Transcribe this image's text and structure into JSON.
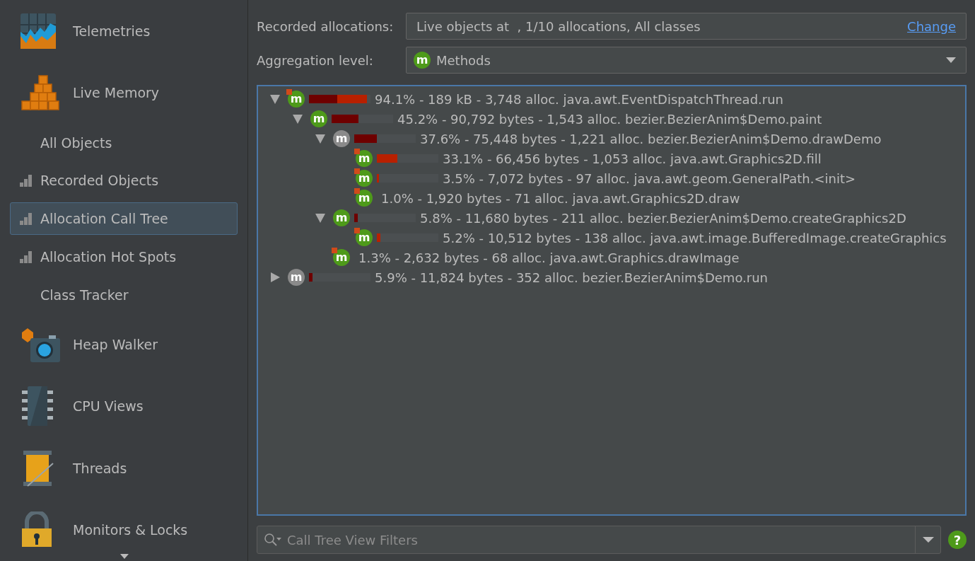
{
  "sidebar": {
    "items": [
      {
        "kind": "section",
        "label": "Telemetries",
        "selected": false
      },
      {
        "kind": "section",
        "label": "Live Memory",
        "selected": false
      },
      {
        "kind": "view",
        "recorded": false,
        "label": "All Objects",
        "selected": false
      },
      {
        "kind": "view",
        "recorded": true,
        "label": "Recorded Objects",
        "selected": false
      },
      {
        "kind": "view",
        "recorded": true,
        "label": "Allocation Call Tree",
        "selected": true
      },
      {
        "kind": "view",
        "recorded": true,
        "label": "Allocation Hot Spots",
        "selected": false
      },
      {
        "kind": "view",
        "recorded": false,
        "label": "Class Tracker",
        "selected": false
      },
      {
        "kind": "section",
        "label": "Heap Walker",
        "selected": false
      },
      {
        "kind": "section",
        "label": "CPU Views",
        "selected": false
      },
      {
        "kind": "section",
        "label": "Threads",
        "selected": false
      },
      {
        "kind": "section",
        "label": "Monitors & Locks",
        "selected": false
      }
    ]
  },
  "recorded_allocations": {
    "label": "Recorded allocations:",
    "value": "Live objects at  , 1/10 allocations, All classes",
    "link": "Change"
  },
  "aggregation_level": {
    "label": "Aggregation level:",
    "icon_text": "m",
    "value": "Methods"
  },
  "tree": [
    {
      "expanded": true,
      "icon_text": "m",
      "greyed": false,
      "hot": true,
      "bars": [
        {
          "kind": "inherent",
          "level": 0.46
        },
        {
          "kind": "self",
          "level": 0.48
        }
      ],
      "text": "94.1% - 189 kB - 3,748 alloc. java.awt.EventDispatchThread.run",
      "children": [
        {
          "expanded": true,
          "icon_text": "m",
          "greyed": false,
          "hot": false,
          "bars": [
            {
              "kind": "inherent",
              "level": 0.44
            }
          ],
          "text": "45.2% - 90,792 bytes - 1,543 alloc. bezier.BezierAnim$Demo.paint",
          "children": [
            {
              "expanded": true,
              "icon_text": "m",
              "greyed": true,
              "hot": false,
              "bars": [
                {
                  "kind": "inherent",
                  "level": 0.37
                }
              ],
              "text": "37.6% - 75,448 bytes - 1,221 alloc. bezier.BezierAnim$Demo.drawDemo",
              "children": [
                {
                  "icon_text": "m",
                  "greyed": false,
                  "hot": true,
                  "bars": [
                    {
                      "kind": "self",
                      "level": 0.33
                    }
                  ],
                  "text": "33.1% - 66,456 bytes - 1,053 alloc. java.awt.Graphics2D.fill"
                },
                {
                  "icon_text": "m",
                  "greyed": false,
                  "hot": true,
                  "bars": [
                    {
                      "kind": "self",
                      "level": 0.035
                    }
                  ],
                  "text": "3.5% - 7,072 bytes - 97 alloc. java.awt.geom.GeneralPath.<init>"
                },
                {
                  "icon_text": "m",
                  "greyed": false,
                  "hot": true,
                  "text": "1.0% - 1,920 bytes - 71 alloc. java.awt.Graphics2D.draw"
                }
              ]
            },
            {
              "expanded": true,
              "icon_text": "m",
              "greyed": false,
              "hot": false,
              "bars": [
                {
                  "kind": "inherent",
                  "level": 0.058
                }
              ],
              "text": "5.8% - 11,680 bytes - 211 alloc. bezier.BezierAnim$Demo.createGraphics2D",
              "children": [
                {
                  "icon_text": "m",
                  "greyed": false,
                  "hot": true,
                  "bars": [
                    {
                      "kind": "self",
                      "level": 0.052
                    }
                  ],
                  "text": "5.2% - 10,512 bytes - 138 alloc. java.awt.image.BufferedImage.createGraphics"
                }
              ]
            },
            {
              "icon_text": "m",
              "greyed": false,
              "hot": true,
              "text": "1.3% - 2,632 bytes - 68 alloc. java.awt.Graphics.drawImage"
            }
          ]
        }
      ]
    },
    {
      "expanded": false,
      "icon_text": "m",
      "greyed": true,
      "hot": false,
      "bars": [
        {
          "kind": "inherent",
          "level": 0.059
        }
      ],
      "text": "5.9% - 11,824 bytes - 352 alloc. bezier.BezierAnim$Demo.run"
    }
  ],
  "filter": {
    "placeholder": "Call Tree View Filters"
  },
  "help": {
    "text": "?"
  }
}
